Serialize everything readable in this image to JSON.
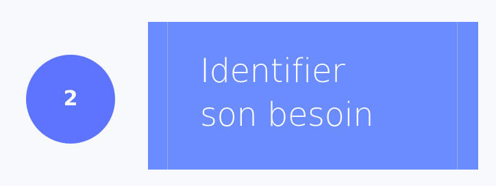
{
  "step": {
    "number": "2",
    "title_lines": [
      "Identifier",
      "son besoin"
    ]
  },
  "colors": {
    "background": "#f8f9fd",
    "badge": "#5d74ff",
    "card": "#6b8cff",
    "text": "#ffffff"
  }
}
